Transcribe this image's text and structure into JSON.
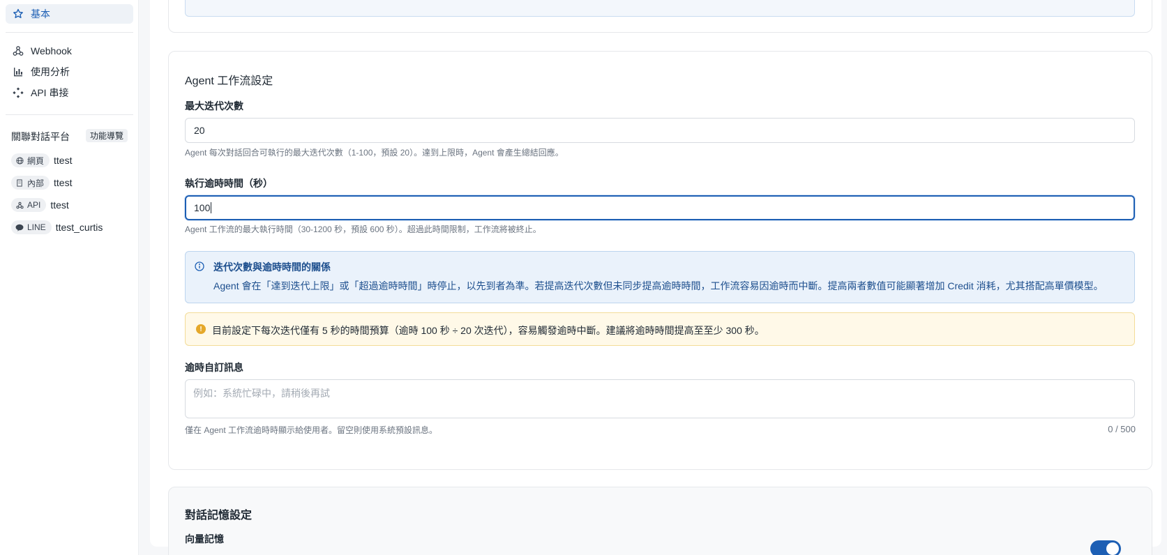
{
  "sidebar": {
    "nav": [
      {
        "label": "基本",
        "icon": "star-icon",
        "active": true
      },
      {
        "label": "Webhook",
        "icon": "webhook-icon"
      },
      {
        "label": "使用分析",
        "icon": "bar-chart-icon"
      },
      {
        "label": "API 串接",
        "icon": "api-icon"
      }
    ],
    "platforms_title": "關聯對話平台",
    "guide_label": "功能導覽",
    "platforms": [
      {
        "tag": "網頁",
        "icon": "globe-icon",
        "name": "ttest"
      },
      {
        "tag": "內部",
        "icon": "building-icon",
        "name": "ttest"
      },
      {
        "tag": "API",
        "icon": "webhook-icon",
        "name": "ttest"
      },
      {
        "tag": "LINE",
        "icon": "chat-bubble-icon",
        "name": "ttest_curtis"
      }
    ]
  },
  "agent": {
    "title": "Agent 工作流設定",
    "max_iter_label": "最大迭代次數",
    "max_iter_value": "20",
    "max_iter_help": "Agent 每次對話回合可執行的最大迭代次數（1-100，預設 20）。達到上限時，Agent 會產生總結回應。",
    "timeout_label": "執行逾時時間（秒）",
    "timeout_value": "100",
    "timeout_help": "Agent 工作流的最大執行時間（30-1200 秒，預設 600 秒）。超過此時間限制，工作流將被終止。",
    "info_title": "迭代次數與逾時時間的關係",
    "info_body": "Agent 會在「達到迭代上限」或「超過逾時時間」時停止，以先到者為準。若提高迭代次數但未同步提高逾時時間，工作流容易因逾時而中斷。提高兩者數值可能顯著增加 Credit 消耗，尤其搭配高單價模型。",
    "warning": "目前設定下每次迭代僅有 5 秒的時間預算（逾時 100 秒 ÷ 20 次迭代），容易觸發逾時中斷。建議將逾時時間提高至至少 300 秒。",
    "timeout_msg_label": "逾時自訂訊息",
    "timeout_msg_placeholder": "例如：系統忙碌中，請稍後再試",
    "timeout_msg_help": "僅在 Agent 工作流逾時時顯示給使用者。留空則使用系統預設訊息。",
    "timeout_msg_counter": "0 / 500"
  },
  "memory": {
    "title": "對話記憶設定",
    "vector_label": "向量記憶",
    "vector_enabled": true
  },
  "colors": {
    "accent": "#1d5fb4",
    "info_bg": "#eaf2fb",
    "warn_bg": "#fff9e8",
    "warn_icon": "#e5a82a"
  }
}
